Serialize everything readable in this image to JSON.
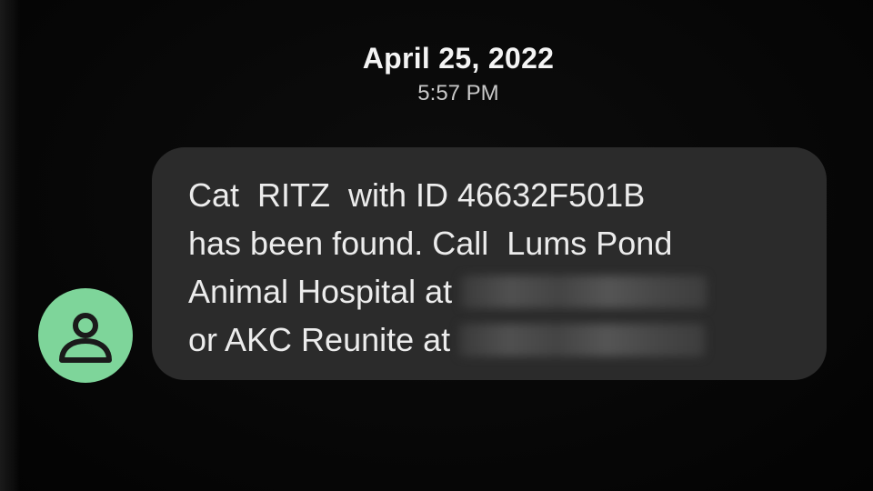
{
  "header": {
    "date": "April 25, 2022",
    "time": "5:57 PM"
  },
  "message": {
    "line1": "Cat  RITZ  with ID 46632F501B",
    "line2": "has been found. Call  Lums Pond",
    "line3": "Animal Hospital at",
    "line4": "or AKC Reunite at"
  },
  "icons": {
    "avatar": "person-icon"
  },
  "colors": {
    "background": "#050505",
    "bubble": "#2b2b2b",
    "avatar": "#7ed59a",
    "avatar_glyph": "#1a1a1a",
    "text": "#ececec"
  }
}
